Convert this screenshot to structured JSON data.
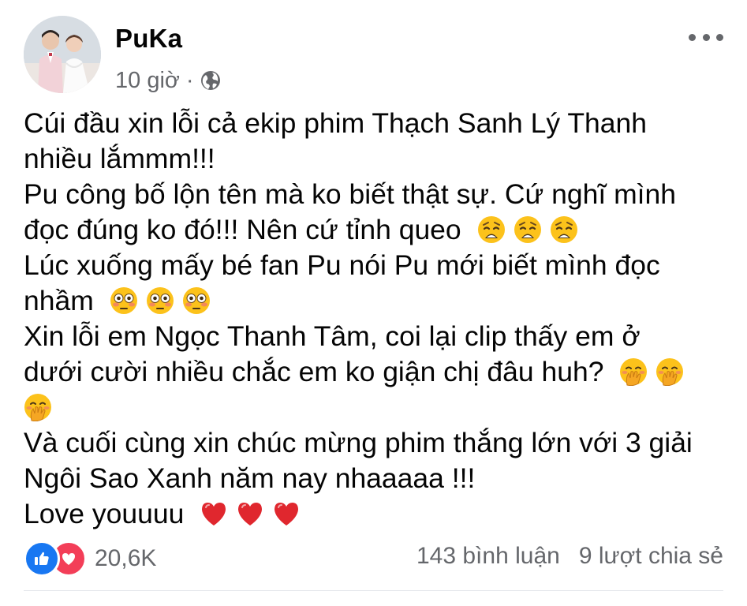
{
  "post": {
    "author": "PuKa",
    "time": "10 giờ",
    "separator": "·",
    "privacy_icon": "globe-icon",
    "more_icon": "more-options-icon",
    "lines": [
      {
        "text": "Cúi đầu xin lỗi cả ekip phim Thạch Sanh Lý Thanh",
        "emoji": ""
      },
      {
        "text": "nhiều lắmmm!!!",
        "emoji": ""
      },
      {
        "text": "Pu công bố lộn tên mà ko biết thật sự. Cứ nghĩ mình",
        "emoji": ""
      },
      {
        "text": "đọc đúng ko đó!!! Nên cứ tỉnh queo ",
        "emoji": "weary-face"
      },
      {
        "text": "Lúc xuống mấy bé fan Pu nói Pu mới biết mình đọc",
        "emoji": ""
      },
      {
        "text": "nhầm ",
        "emoji": "flushed-face"
      },
      {
        "text": "Xin lỗi em Ngọc Thanh Tâm, coi lại clip thấy em ở",
        "emoji": ""
      },
      {
        "text": "dưới cười nhiều chắc em ko giận chị đâu huh? ",
        "emoji": "hand-over-mouth-face"
      },
      {
        "text": "",
        "emoji": "hand-over-mouth-face"
      },
      {
        "text": "Và cuối cùng xin chúc mừng phim thắng lớn với 3 giải",
        "emoji": ""
      },
      {
        "text": "Ngôi Sao Xanh năm nay nhaaaaa !!!",
        "emoji": ""
      },
      {
        "text": "Love youuuu ",
        "emoji": "red-heart"
      }
    ]
  },
  "footer": {
    "reaction_icons": [
      "like-icon",
      "love-icon"
    ],
    "reaction_count": "20,6K",
    "comments": "143 bình luận",
    "shares": "9 lượt chia sẻ"
  },
  "colors": {
    "text": "#050505",
    "secondary": "#65676b",
    "like": "#1877f2",
    "love": "#f33e58",
    "emoji_yellow": "#fcc21b",
    "heart_red": "#e0272e"
  }
}
